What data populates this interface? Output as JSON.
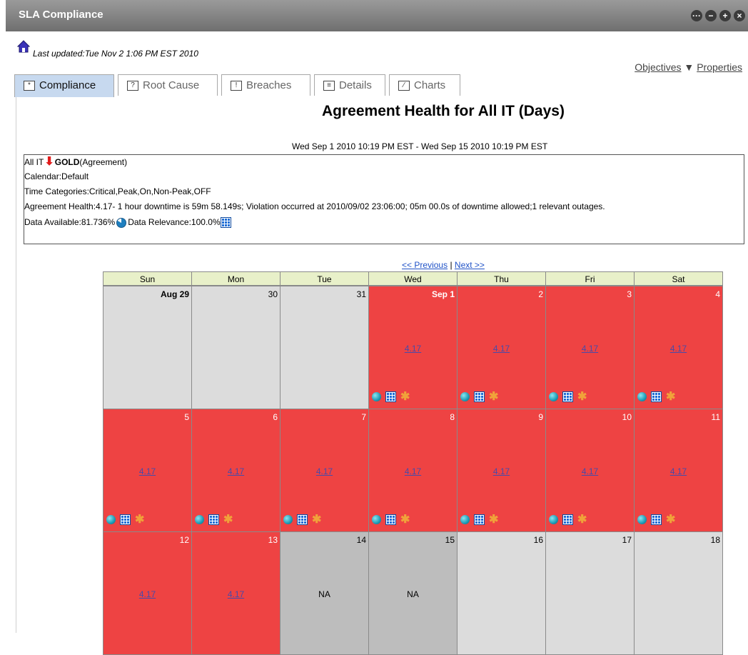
{
  "window": {
    "title": "SLA Compliance"
  },
  "header": {
    "last_updated_label": "Last updated:",
    "last_updated_value": "Tue Nov 2 1:06 PM EST 2010",
    "objectives_label": "Objectives",
    "properties_label": "Properties"
  },
  "tabs": [
    {
      "label": "Compliance",
      "icon": "asterisk-icon",
      "active": true
    },
    {
      "label": "Root Cause",
      "icon": "question-icon",
      "active": false
    },
    {
      "label": "Breaches",
      "icon": "exclamation-icon",
      "active": false
    },
    {
      "label": "Details",
      "icon": "list-icon",
      "active": false
    },
    {
      "label": "Charts",
      "icon": "chart-icon",
      "active": false
    }
  ],
  "report": {
    "title": "Agreement Health for All IT (Days)",
    "date_range": "Wed Sep 1 2010 10:19 PM EST - Wed Sep 15 2010 10:19 PM EST"
  },
  "info": {
    "service_prefix": "All IT",
    "service_name": "GOLD",
    "service_suffix": "(Agreement)",
    "calendar": "Calendar:Default",
    "time_categories": "Time Categories:Critical,Peak,On,Non-Peak,OFF",
    "agreement_health": "Agreement Health:4.17- 1 hour downtime is 59m 58.149s; Violation occurred at 2010/09/02 23:06:00; 05m 00.0s of downtime allowed;1 relevant outages.",
    "data_available": "Data Available:81.736%",
    "data_relevance": "Data Relevance:100.0%"
  },
  "pager": {
    "previous": "<< Previous",
    "separator": "|",
    "next": "Next >>"
  },
  "calendar": {
    "days": [
      "Sun",
      "Mon",
      "Tue",
      "Wed",
      "Thu",
      "Fri",
      "Sat"
    ],
    "weeks": [
      [
        {
          "label": "Aug 29",
          "status": "gray",
          "value": "",
          "bold": true
        },
        {
          "label": "30",
          "status": "gray",
          "value": ""
        },
        {
          "label": "31",
          "status": "gray",
          "value": ""
        },
        {
          "label": "Sep 1",
          "status": "red",
          "value": "4.17",
          "bold": true,
          "icons": true
        },
        {
          "label": "2",
          "status": "red",
          "value": "4.17",
          "icons": true
        },
        {
          "label": "3",
          "status": "red",
          "value": "4.17",
          "icons": true
        },
        {
          "label": "4",
          "status": "red",
          "value": "4.17",
          "icons": true
        }
      ],
      [
        {
          "label": "5",
          "status": "red",
          "value": "4.17",
          "icons": true
        },
        {
          "label": "6",
          "status": "red",
          "value": "4.17",
          "icons": true
        },
        {
          "label": "7",
          "status": "red",
          "value": "4.17",
          "icons": true
        },
        {
          "label": "8",
          "status": "red",
          "value": "4.17",
          "icons": true
        },
        {
          "label": "9",
          "status": "red",
          "value": "4.17",
          "icons": true
        },
        {
          "label": "10",
          "status": "red",
          "value": "4.17",
          "icons": true
        },
        {
          "label": "11",
          "status": "red",
          "value": "4.17",
          "icons": true
        }
      ],
      [
        {
          "label": "12",
          "status": "red",
          "value": "4.17"
        },
        {
          "label": "13",
          "status": "red",
          "value": "4.17"
        },
        {
          "label": "14",
          "status": "dark",
          "value": "NA",
          "na": true
        },
        {
          "label": "15",
          "status": "dark",
          "value": "NA",
          "na": true
        },
        {
          "label": "16",
          "status": "gray",
          "value": ""
        },
        {
          "label": "17",
          "status": "gray",
          "value": ""
        },
        {
          "label": "18",
          "status": "gray",
          "value": ""
        }
      ]
    ]
  },
  "colors": {
    "violation": "#ee4343",
    "inactive": "#dcdcdc",
    "na": "#bdbdbd",
    "header": "#e8f0c9",
    "tab_active": "#c7d9ef"
  }
}
